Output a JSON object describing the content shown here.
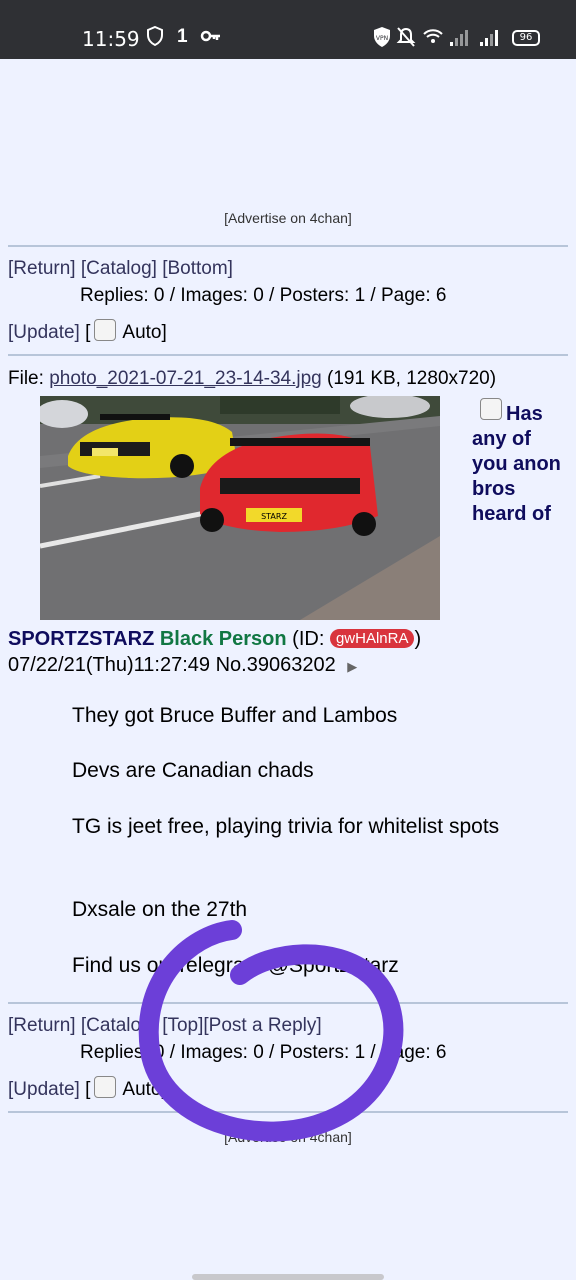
{
  "status_bar": {
    "time": "11:59",
    "notif_badge": "1",
    "battery": "96"
  },
  "ad_label": "[Advertise on 4chan]",
  "nav_top": {
    "return": "[Return]",
    "catalog": "[Catalog]",
    "bottom": "[Bottom]"
  },
  "stats": "Replies: 0 / Images: 0 / Posters: 1 / Page: 6",
  "update": "[Update]",
  "bracket_open": "[",
  "auto_label": "Auto]",
  "post": {
    "file_prefix": "File:",
    "file_name": "photo_2021-07-21_23-14-34.jpg",
    "file_info": "(191 KB, 1280x720)",
    "plate": "STARZ",
    "subject_lines": [
      "Has",
      "any of",
      "you anon",
      "bros",
      "heard of"
    ],
    "subject_name": "SPORTZSTARZ",
    "poster_name": "Black Person",
    "id_prefix": "(ID:",
    "id": "gwHAlnRA",
    "id_suffix": ")",
    "datetime": "07/22/21(Thu)11:27:49",
    "post_no": "No.39063202",
    "arrow": "▶",
    "message": [
      "They got Bruce Buffer and Lambos",
      "Devs are Canadian chads",
      "TG is jeet free, playing trivia for whitelist spots",
      "Dxsale on the 27th",
      "Find us on Telegram @SportzStarz"
    ]
  },
  "nav_bottom": {
    "return": "[Return]",
    "catalog": "[Catalog]",
    "top": "[Top]",
    "post_reply": "[Post a Reply]"
  },
  "colors": {
    "page_bg": "#eef2ff",
    "link": "#34345c",
    "name": "#117743",
    "subject": "#0f0c5d",
    "id_badge": "#d9343d",
    "annotation": "#6c3fd8"
  }
}
